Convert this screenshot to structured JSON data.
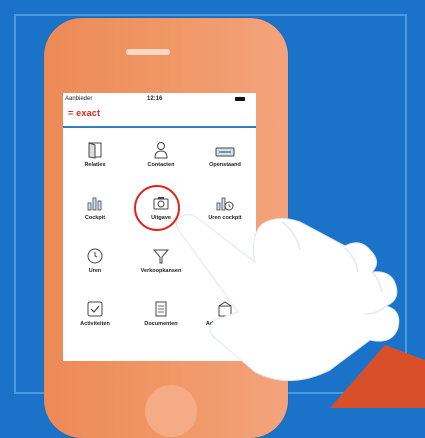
{
  "status_bar": {
    "carrier": "Aanbieder",
    "time": "12:16"
  },
  "app": {
    "logo": "= exact"
  },
  "tiles": [
    {
      "label": "Relaties",
      "icon": "door-icon"
    },
    {
      "label": "Contacten",
      "icon": "person-icon"
    },
    {
      "label": "Openstaand",
      "icon": "tray-icon"
    },
    {
      "label": "Cockpit",
      "icon": "bar-chart-icon"
    },
    {
      "label": "Uitgave",
      "icon": "camera-icon"
    },
    {
      "label": "Uren cockpit",
      "icon": "chart-clock-icon"
    },
    {
      "label": "Uren",
      "icon": "clock-icon"
    },
    {
      "label": "Verkoopkansen",
      "icon": "funnel-icon"
    },
    {
      "label": "",
      "icon": "document-icon"
    },
    {
      "label": "Activiteiten",
      "icon": "checkbox-icon"
    },
    {
      "label": "Documenten",
      "icon": "documents-icon"
    },
    {
      "label": "Administraties",
      "icon": "building-icon"
    }
  ],
  "colors": {
    "background": "#1a73c8",
    "phone": "#f09766",
    "accent": "#e2251c",
    "divider": "#2f7fc8"
  }
}
